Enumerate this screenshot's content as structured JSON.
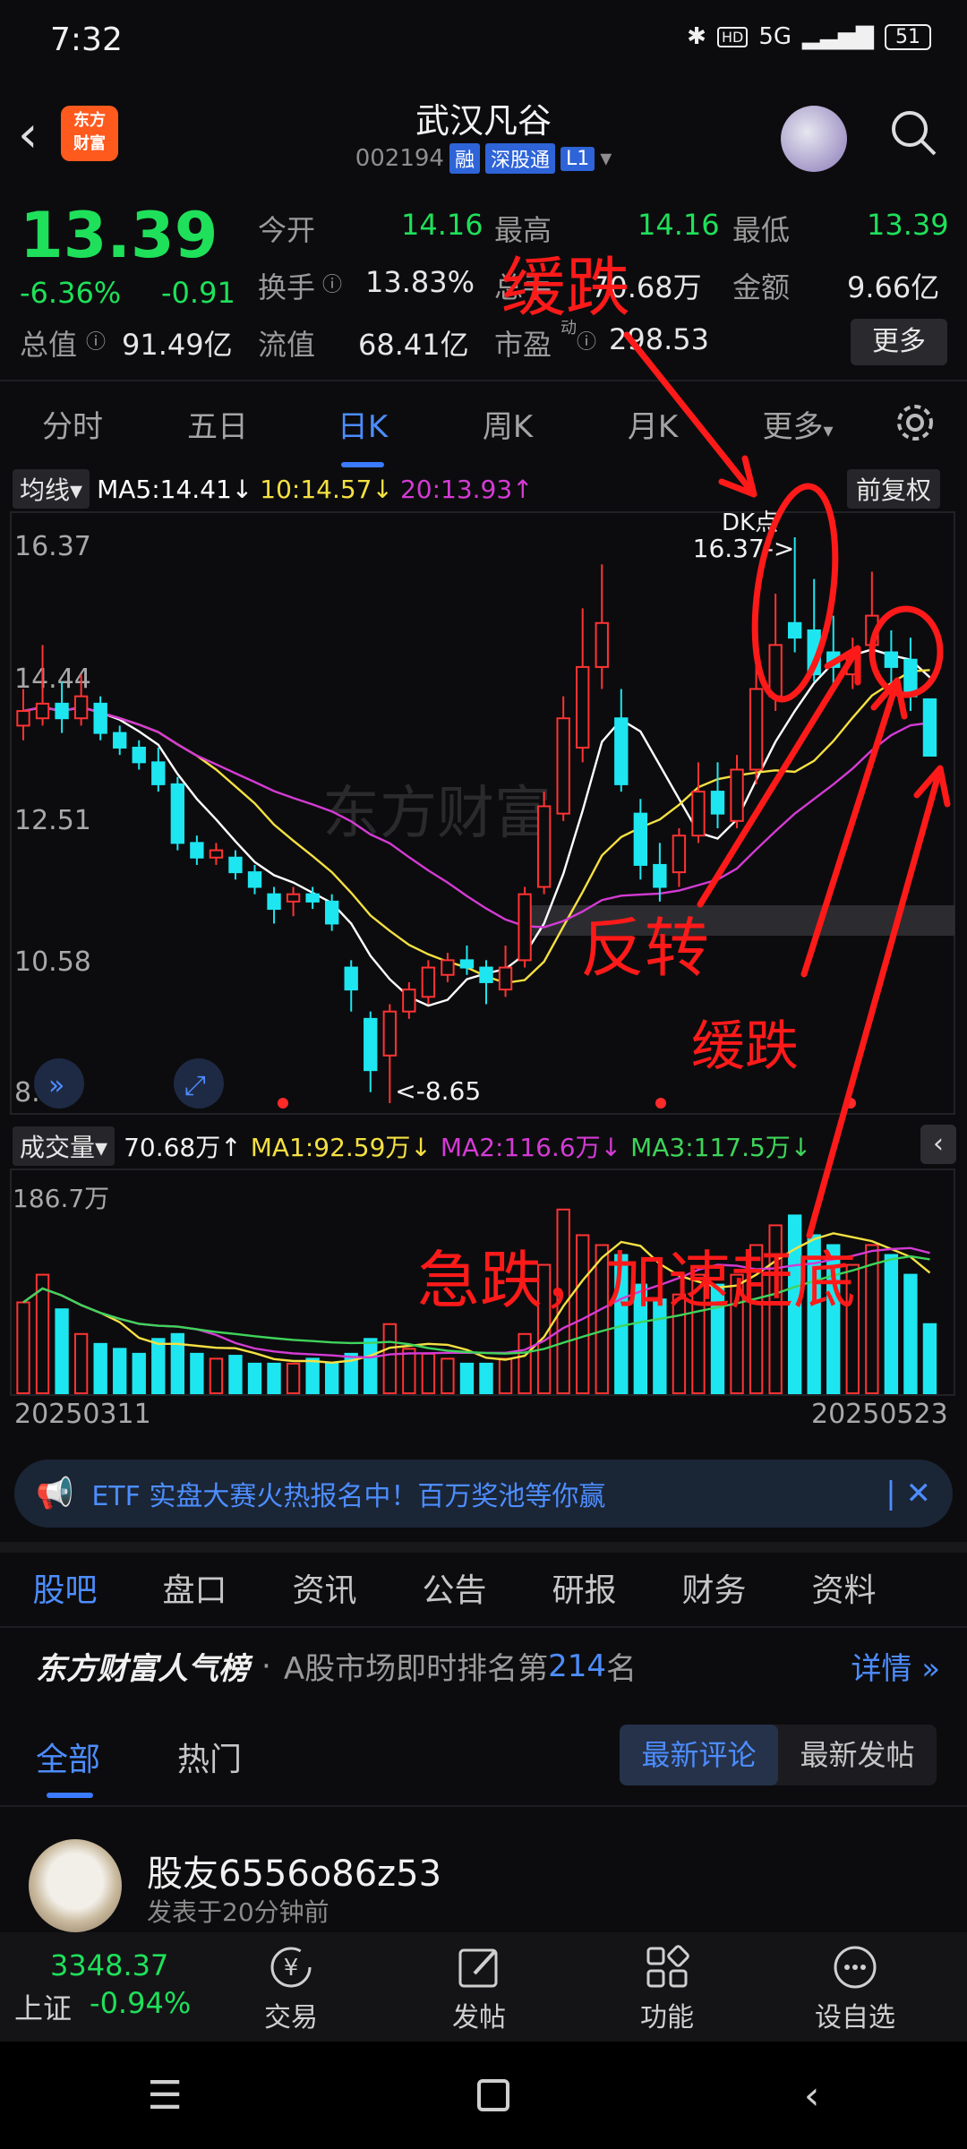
{
  "status_bar": {
    "time": "7:32",
    "network": "5G",
    "battery": "51"
  },
  "header": {
    "logo_text": "东方\n财富",
    "stock_name": "武汉凡谷",
    "stock_code": "002194",
    "tags": [
      "融",
      "深股通",
      "L1"
    ]
  },
  "quote": {
    "price": "13.39",
    "change_pct": "-6.36%",
    "change_abs": "-0.91",
    "open_label": "今开",
    "open": "14.16",
    "high_label": "最高",
    "high": "14.16",
    "low_label": "最低",
    "low": "13.39",
    "turnover_label": "换手",
    "turnover": "13.83%",
    "volume_label": "总手",
    "volume": "70.68万",
    "amount_label": "金额",
    "amount": "9.66亿",
    "mktcap_label": "总值",
    "mktcap": "91.49亿",
    "float_label": "流值",
    "float": "68.41亿",
    "pe_label": "市盈",
    "pe_sup": "动",
    "pe": "298.53",
    "more_label": "更多"
  },
  "period_tabs": [
    "分时",
    "五日",
    "日K",
    "周K",
    "月K",
    "更多"
  ],
  "active_period": "日K",
  "ma_legend": {
    "selector": "均线",
    "ma5": "MA5:14.41↓",
    "ma10": "10:14.57↓",
    "ma20": "20:13.93↑",
    "colors": {
      "ma5": "#ffffff",
      "ma10": "#f5e042",
      "ma20": "#d43bd4"
    }
  },
  "adjust_label": "前复权",
  "dk_label": "DK点",
  "vol_legend": {
    "selector": "成交量",
    "vol": "70.68万↑",
    "ma1": "MA1:92.59万↓",
    "ma2": "MA2:116.6万↓",
    "ma3": "MA3:117.5万↓"
  },
  "chart_data": {
    "type": "candlestick",
    "y_ticks": [
      "16.37",
      "14.44",
      "12.51",
      "10.58",
      "8.65"
    ],
    "ylim": [
      8.65,
      16.37
    ],
    "max_marker": "16.37->",
    "min_marker": "<-8.65",
    "x_start": "20250311",
    "x_end": "20250523",
    "volume_axis_max": "186.7万",
    "candles": [
      {
        "o": 13.8,
        "c": 14.0,
        "h": 14.3,
        "l": 13.6
      },
      {
        "o": 13.9,
        "c": 14.1,
        "h": 14.9,
        "l": 13.8
      },
      {
        "o": 14.1,
        "c": 13.9,
        "h": 14.4,
        "l": 13.7
      },
      {
        "o": 13.9,
        "c": 14.2,
        "h": 14.5,
        "l": 13.8
      },
      {
        "o": 14.1,
        "c": 13.7,
        "h": 14.2,
        "l": 13.6
      },
      {
        "o": 13.7,
        "c": 13.5,
        "h": 13.8,
        "l": 13.4
      },
      {
        "o": 13.5,
        "c": 13.3,
        "h": 13.6,
        "l": 13.2
      },
      {
        "o": 13.3,
        "c": 13.0,
        "h": 13.5,
        "l": 12.9
      },
      {
        "o": 13.0,
        "c": 12.2,
        "h": 13.1,
        "l": 12.1
      },
      {
        "o": 12.2,
        "c": 12.0,
        "h": 12.3,
        "l": 11.9
      },
      {
        "o": 12.0,
        "c": 12.1,
        "h": 12.2,
        "l": 11.9
      },
      {
        "o": 12.0,
        "c": 11.8,
        "h": 12.1,
        "l": 11.7
      },
      {
        "o": 11.8,
        "c": 11.6,
        "h": 11.9,
        "l": 11.5
      },
      {
        "o": 11.5,
        "c": 11.3,
        "h": 11.6,
        "l": 11.1
      },
      {
        "o": 11.4,
        "c": 11.5,
        "h": 11.6,
        "l": 11.2
      },
      {
        "o": 11.5,
        "c": 11.4,
        "h": 11.6,
        "l": 11.3
      },
      {
        "o": 11.4,
        "c": 11.1,
        "h": 11.5,
        "l": 11.0
      },
      {
        "o": 10.5,
        "c": 10.2,
        "h": 10.6,
        "l": 9.9
      },
      {
        "o": 9.8,
        "c": 9.1,
        "h": 9.9,
        "l": 8.8
      },
      {
        "o": 9.3,
        "c": 9.9,
        "h": 10.0,
        "l": 8.65
      },
      {
        "o": 9.9,
        "c": 10.2,
        "h": 10.3,
        "l": 9.8
      },
      {
        "o": 10.1,
        "c": 10.5,
        "h": 10.6,
        "l": 10.0
      },
      {
        "o": 10.4,
        "c": 10.6,
        "h": 10.7,
        "l": 10.3
      },
      {
        "o": 10.6,
        "c": 10.5,
        "h": 10.8,
        "l": 10.4
      },
      {
        "o": 10.5,
        "c": 10.3,
        "h": 10.6,
        "l": 10.0
      },
      {
        "o": 10.2,
        "c": 10.5,
        "h": 10.8,
        "l": 10.1
      },
      {
        "o": 10.6,
        "c": 11.5,
        "h": 11.6,
        "l": 10.5
      },
      {
        "o": 11.6,
        "c": 12.7,
        "h": 12.9,
        "l": 11.5
      },
      {
        "o": 12.6,
        "c": 13.9,
        "h": 14.2,
        "l": 12.5
      },
      {
        "o": 13.5,
        "c": 14.6,
        "h": 15.4,
        "l": 13.3
      },
      {
        "o": 14.6,
        "c": 15.2,
        "h": 16.0,
        "l": 14.3
      },
      {
        "o": 13.9,
        "c": 13.0,
        "h": 14.3,
        "l": 12.9
      },
      {
        "o": 12.6,
        "c": 11.9,
        "h": 12.8,
        "l": 11.7
      },
      {
        "o": 11.9,
        "c": 11.6,
        "h": 12.2,
        "l": 11.4
      },
      {
        "o": 11.8,
        "c": 12.3,
        "h": 12.4,
        "l": 11.6
      },
      {
        "o": 12.3,
        "c": 12.9,
        "h": 13.3,
        "l": 12.2
      },
      {
        "o": 12.9,
        "c": 12.6,
        "h": 13.3,
        "l": 12.4
      },
      {
        "o": 12.5,
        "c": 13.2,
        "h": 13.4,
        "l": 12.4
      },
      {
        "o": 13.2,
        "c": 14.3,
        "h": 15.4,
        "l": 13.0
      },
      {
        "o": 14.2,
        "c": 14.9,
        "h": 15.6,
        "l": 14.0
      },
      {
        "o": 15.2,
        "c": 15.0,
        "h": 16.37,
        "l": 14.8
      },
      {
        "o": 15.1,
        "c": 14.5,
        "h": 15.8,
        "l": 14.4
      },
      {
        "o": 14.8,
        "c": 14.6,
        "h": 15.3,
        "l": 14.3
      },
      {
        "o": 14.5,
        "c": 14.8,
        "h": 15.0,
        "l": 14.3
      },
      {
        "o": 14.9,
        "c": 15.3,
        "h": 15.9,
        "l": 14.7
      },
      {
        "o": 14.8,
        "c": 14.6,
        "h": 15.1,
        "l": 14.2
      },
      {
        "o": 14.7,
        "c": 14.2,
        "h": 15.0,
        "l": 14.0
      },
      {
        "o": 14.16,
        "c": 13.39,
        "h": 14.16,
        "l": 13.39
      }
    ],
    "volumes": [
      92,
      120,
      85,
      60,
      50,
      45,
      40,
      55,
      60,
      40,
      35,
      38,
      30,
      30,
      30,
      35,
      30,
      40,
      55,
      70,
      45,
      40,
      35,
      30,
      30,
      35,
      60,
      130,
      186,
      160,
      150,
      140,
      110,
      95,
      100,
      120,
      110,
      120,
      150,
      170,
      180,
      160,
      150,
      130,
      150,
      140,
      120,
      70
    ]
  },
  "annotations": {
    "slow_fall_1": "缓跌",
    "reversal": "反转",
    "slow_fall_2": "缓跌",
    "accelerate": "急跌，加速赶底"
  },
  "watermark": "东方财富",
  "banner": {
    "text": "ETF 实盘大赛火热报名中！百万奖池等你赢"
  },
  "sub_tabs": [
    "股吧",
    "盘口",
    "资讯",
    "公告",
    "研报",
    "财务",
    "资料"
  ],
  "rank": {
    "brand": "东方财富人气榜",
    "text": "A股市场即时排名第",
    "rank": "214",
    "suffix": "名",
    "detail": "详情"
  },
  "filter_tabs": {
    "all": "全部",
    "hot": "热门",
    "latest_comment": "最新评论",
    "latest_post": "最新发帖"
  },
  "post": {
    "user": "股友6556o86z53",
    "time": "发表于20分钟前"
  },
  "bottom_bar": {
    "index_value": "3348.37",
    "index_name": "上证",
    "index_change": "-0.94%",
    "items": [
      "交易",
      "发帖",
      "功能",
      "设自选"
    ]
  },
  "nav": [
    "menu-icon",
    "home-icon",
    "back-icon"
  ]
}
